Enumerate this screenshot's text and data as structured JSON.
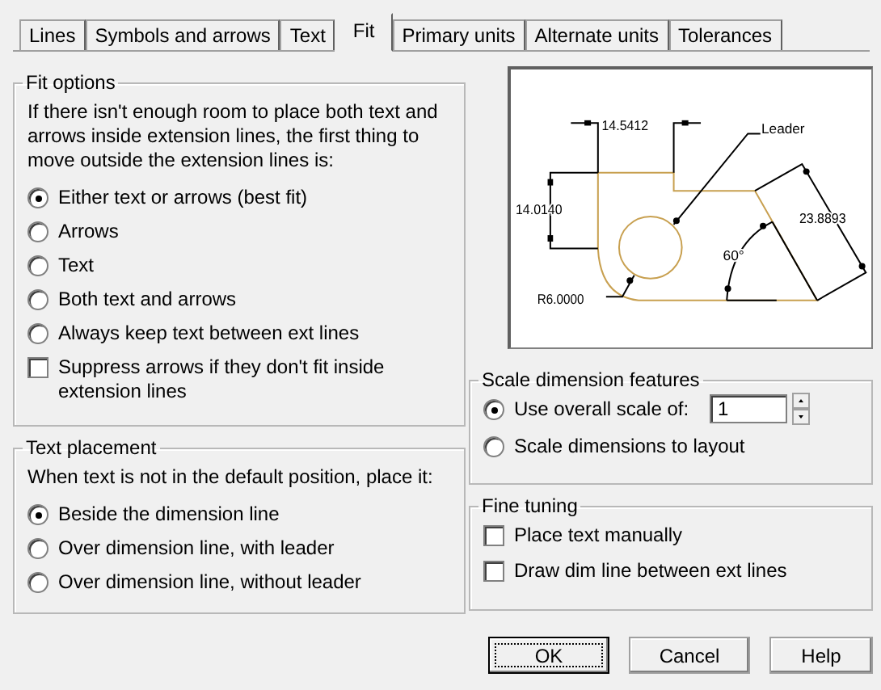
{
  "tabs": [
    {
      "label": "Lines",
      "selected": false
    },
    {
      "label": "Symbols and arrows",
      "selected": false
    },
    {
      "label": "Text",
      "selected": false
    },
    {
      "label": "Fit",
      "selected": true
    },
    {
      "label": "Primary units",
      "selected": false
    },
    {
      "label": "Alternate units",
      "selected": false
    },
    {
      "label": "Tolerances",
      "selected": false
    }
  ],
  "fit_options": {
    "title": "Fit options",
    "description": "If there isn't enough room to place both text and arrows inside extension lines, the first thing to move outside the extension lines is:",
    "options": [
      {
        "label": "Either text or arrows (best fit)",
        "selected": true
      },
      {
        "label": "Arrows",
        "selected": false
      },
      {
        "label": "Text",
        "selected": false
      },
      {
        "label": "Both text and arrows",
        "selected": false
      },
      {
        "label": "Always keep text between ext lines",
        "selected": false
      }
    ],
    "suppress_arrows": {
      "label": "Suppress arrows if they don't fit inside extension lines",
      "checked": false
    }
  },
  "text_placement": {
    "title": "Text placement",
    "description": "When text is not in the default position, place it:",
    "options": [
      {
        "label": "Beside the dimension line",
        "selected": true
      },
      {
        "label": "Over dimension line, with leader",
        "selected": false
      },
      {
        "label": "Over dimension line, without leader",
        "selected": false
      }
    ]
  },
  "preview": {
    "labels": [
      "14.5412",
      "Leader",
      "14.0140",
      "23.8893",
      "60°",
      "R6.0000"
    ]
  },
  "scale": {
    "title": "Scale dimension features",
    "options": [
      {
        "label": "Use overall scale of:",
        "selected": true
      },
      {
        "label": "Scale dimensions to layout",
        "selected": false
      }
    ],
    "scale_field": {
      "value": "1"
    }
  },
  "fine_tuning": {
    "title": "Fine tuning",
    "options": [
      {
        "label": "Place text manually",
        "checked": false
      },
      {
        "label": "Draw dim line between ext lines",
        "checked": false
      }
    ]
  },
  "buttons": [
    {
      "label": "OK",
      "default": true
    },
    {
      "label": "Cancel",
      "default": false
    },
    {
      "label": "Help",
      "default": false
    }
  ]
}
